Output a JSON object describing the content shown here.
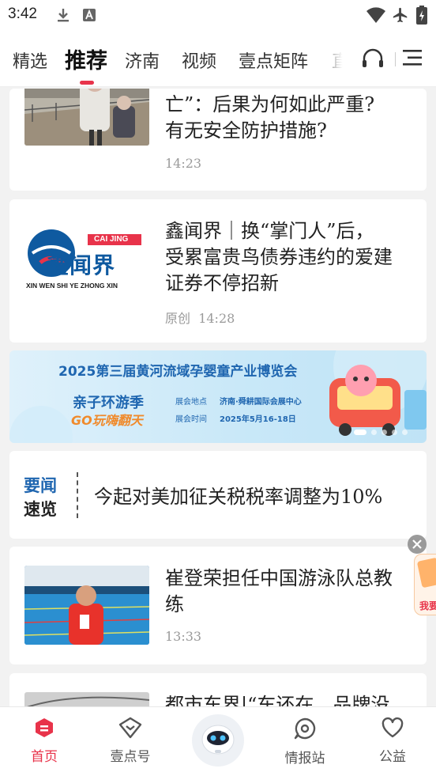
{
  "status_bar": {
    "time": "3:42"
  },
  "top_nav": {
    "tabs": [
      {
        "label": "精选"
      },
      {
        "label": "推荐"
      },
      {
        "label": "济南"
      },
      {
        "label": "视频"
      },
      {
        "label": "壹点矩阵"
      },
      {
        "label": "直"
      }
    ]
  },
  "feed": {
    "items": [
      {
        "headline_lines": [
          "亡”：后果为何如此严重?",
          "有无安全防护措施?"
        ],
        "time": "14:23"
      },
      {
        "headline_lines": [
          "鑫闻界｜换“掌门人”后，",
          "受累富贵鸟债券违约的爱建",
          "证券不停招新"
        ],
        "source": "原创",
        "time": "14:28",
        "thumb_logo": {
          "top": "CAI JING",
          "main": "鑫闻界",
          "sub": "XIN WEN SHI YE ZHONG XIN"
        }
      },
      {
        "headline_lines": [
          "崔登荣担任中国游泳队总教",
          "练"
        ],
        "time": "13:33"
      },
      {
        "headline_lines": [
          "都市东界|“车还在，品牌没"
        ]
      }
    ],
    "banner": {
      "title": "2025第三届黄河流域孕婴童产业博览会",
      "slogan_top": "亲子环游季",
      "slogan_bottom": "GO玩嗨翻天",
      "venue_label": "展会地点",
      "venue": "济南·舜耕国际会展中心",
      "date_label": "展会时间",
      "date": "2025年5月16-18日",
      "page_count": 5,
      "active_page": 0
    },
    "news_brief": {
      "badge_top": "要闻",
      "badge_bottom": "速览",
      "headline": "今起对美加征关税税率调整为10%"
    },
    "floating_promo": {
      "label": "我要"
    }
  },
  "bottom_nav": {
    "items": [
      {
        "label": "首页"
      },
      {
        "label": "壹点号"
      },
      {
        "label": ""
      },
      {
        "label": "情报站"
      },
      {
        "label": "公益"
      }
    ]
  },
  "colors": {
    "brand_red": "#e8334a",
    "text_dark": "#222222",
    "text_meta": "#9a9a9a"
  }
}
